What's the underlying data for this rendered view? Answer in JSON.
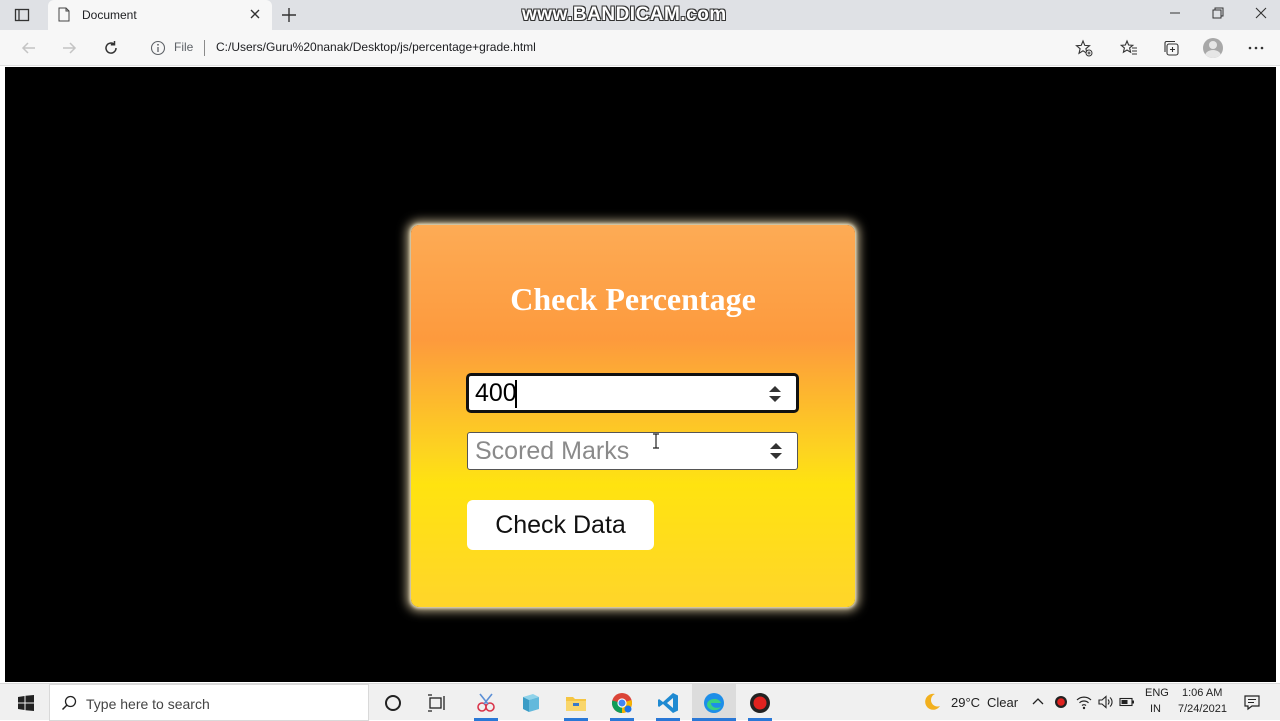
{
  "browser": {
    "tab_title": "Document",
    "address_prefix": "File",
    "url": "C:/Users/Guru%20nanak/Desktop/js/percentage+grade.html"
  },
  "watermark": "www.BANDICAM.com",
  "page": {
    "title": "Check Percentage",
    "total_marks": {
      "value": "400"
    },
    "scored_marks": {
      "value": "",
      "placeholder": "Scored Marks"
    },
    "button_label": "Check Data"
  },
  "taskbar": {
    "search_placeholder": "Type here to search",
    "weather_temp": "29°C",
    "weather_desc": "Clear",
    "lang_line1": "ENG",
    "lang_line2": "IN",
    "time": "1:06 AM",
    "date": "7/24/2021"
  },
  "colors": {
    "card_top": "#fdab55",
    "card_mid": "#fd9a3d",
    "card_bottom": "#ffe310",
    "page_bg": "#000000",
    "accent_blue": "#2a78d6"
  }
}
